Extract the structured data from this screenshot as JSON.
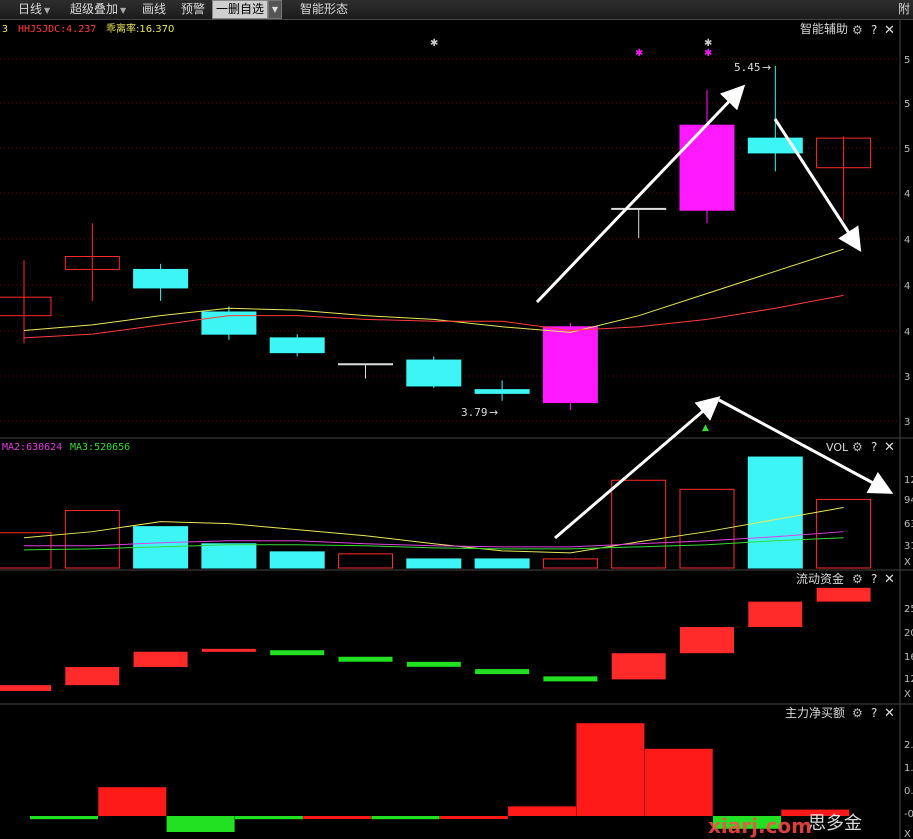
{
  "toolbar": {
    "items": [
      "日线",
      "超级叠加",
      "画线",
      "预警",
      "一删自选",
      "智能形态"
    ],
    "right_edge": "附"
  },
  "colors": {
    "up": "#ff2a2a",
    "down": "#3df5f5",
    "pink": "#ff19ff",
    "ma_yellow": "#e8e85a",
    "ma_red": "#ff3b3b",
    "ma_magenta": "#e040e0",
    "ma_green": "#33dd33",
    "grid": "#6a0000"
  },
  "panels": {
    "main": {
      "indicators": [
        "3",
        "HHJSJDC:4.237",
        "乖离率:16.370"
      ],
      "title": "智能辅助",
      "y_ticks": [
        "5",
        "5",
        "5",
        "4",
        "4",
        "4",
        "4",
        "3",
        "3"
      ],
      "annotations": {
        "high": "5.45",
        "low": "3.79"
      }
    },
    "vol": {
      "indicators": [
        "MA2:630624",
        "MA3:520656"
      ],
      "title": "VOL",
      "y_ticks": [
        "12",
        "94",
        "63",
        "31"
      ],
      "unit": "X"
    },
    "flow": {
      "title": "流动资金",
      "y_ticks": [
        "25",
        "20",
        "16",
        "12"
      ],
      "unit": "X"
    },
    "net": {
      "title": "主力净买额",
      "y_ticks": [
        "2.",
        "1.",
        "0.",
        "-0."
      ],
      "unit": "X"
    }
  },
  "watermark": {
    "text1": "思多金",
    "text2": "xiarj.com"
  },
  "chart_data": {
    "type": "candlestick",
    "candles": [
      {
        "o": 4.1,
        "h": 4.4,
        "l": 3.95,
        "c": 4.2
      },
      {
        "o": 4.35,
        "h": 4.6,
        "l": 4.18,
        "c": 4.42
      },
      {
        "o": 4.35,
        "h": 4.38,
        "l": 4.18,
        "c": 4.25
      },
      {
        "o": 4.12,
        "h": 4.15,
        "l": 3.97,
        "c": 4.0
      },
      {
        "o": 3.98,
        "h": 4.0,
        "l": 3.88,
        "c": 3.9
      },
      {
        "o": 3.84,
        "h": 3.84,
        "l": 3.76,
        "c": 3.84
      },
      {
        "o": 3.86,
        "h": 3.88,
        "l": 3.71,
        "c": 3.72
      },
      {
        "o": 3.7,
        "h": 3.75,
        "l": 3.64,
        "c": 3.68
      },
      {
        "o": 3.63,
        "h": 4.06,
        "l": 3.59,
        "c": 4.04
      },
      {
        "o": 4.68,
        "h": 4.68,
        "l": 4.52,
        "c": 4.68
      },
      {
        "o": 4.67,
        "h": 5.32,
        "l": 4.6,
        "c": 5.13
      },
      {
        "o": 5.06,
        "h": 5.45,
        "l": 4.88,
        "c": 4.98
      },
      {
        "o": 4.9,
        "h": 5.07,
        "l": 4.62,
        "c": 5.06
      }
    ],
    "ma_fast": [
      4.02,
      4.05,
      4.1,
      4.14,
      4.13,
      4.1,
      4.08,
      4.04,
      4.01,
      4.1,
      4.22,
      4.34,
      4.46
    ],
    "ma_slow": [
      3.98,
      4.0,
      4.05,
      4.1,
      4.1,
      4.08,
      4.07,
      4.07,
      4.02,
      4.04,
      4.08,
      4.14,
      4.21
    ],
    "volume": [
      35,
      57,
      41,
      24,
      16,
      14,
      9,
      9,
      9,
      87,
      78,
      110,
      68
    ],
    "flow": [
      12.8,
      15.3,
      17.4,
      17.8,
      17.2,
      16.3,
      15.6,
      14.6,
      13.6,
      17.2,
      20.8,
      24.3,
      26.2
    ],
    "net_buy": [
      -0.1,
      0.9,
      -0.5,
      -0.1,
      0.0,
      -0.1,
      0.0,
      0.3,
      2.9,
      2.1,
      -0.4,
      0.2
    ]
  }
}
